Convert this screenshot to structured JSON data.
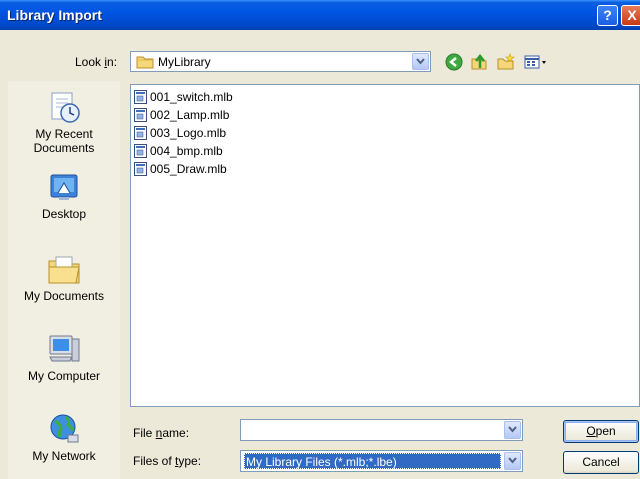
{
  "window": {
    "title": "Library Import"
  },
  "title_buttons": {
    "help": "?",
    "close": "X"
  },
  "lookin": {
    "label_pre": "Look ",
    "label_key": "i",
    "label_post": "n:",
    "value": "MyLibrary"
  },
  "toolbar": {
    "icons": [
      "back-icon",
      "up-folder-icon",
      "new-folder-icon",
      "view-menu-icon"
    ]
  },
  "places": [
    {
      "label": "My Recent Documents",
      "icon": "recent-documents-icon"
    },
    {
      "label": "Desktop",
      "icon": "desktop-icon"
    },
    {
      "label": "My Documents",
      "icon": "my-documents-icon"
    },
    {
      "label": "My Computer",
      "icon": "my-computer-icon"
    },
    {
      "label": "My Network",
      "icon": "my-network-icon"
    }
  ],
  "files": [
    "001_switch.mlb",
    "002_Lamp.mlb",
    "003_Logo.mlb",
    "004_bmp.mlb",
    "005_Draw.mlb"
  ],
  "filename": {
    "label_pre": "File ",
    "label_key": "n",
    "label_post": "ame:",
    "value": ""
  },
  "filetype": {
    "label_pre": "Files of ",
    "label_key": "t",
    "label_post": "ype:",
    "value": "My Library Files (*.mlb;*.lbe)"
  },
  "buttons": {
    "open_key": "O",
    "open_rest": "pen",
    "cancel": "Cancel"
  },
  "colors": {
    "titlebar": "#0054e3",
    "dialog_bg": "#ece9d8",
    "selection": "#316ac5"
  }
}
